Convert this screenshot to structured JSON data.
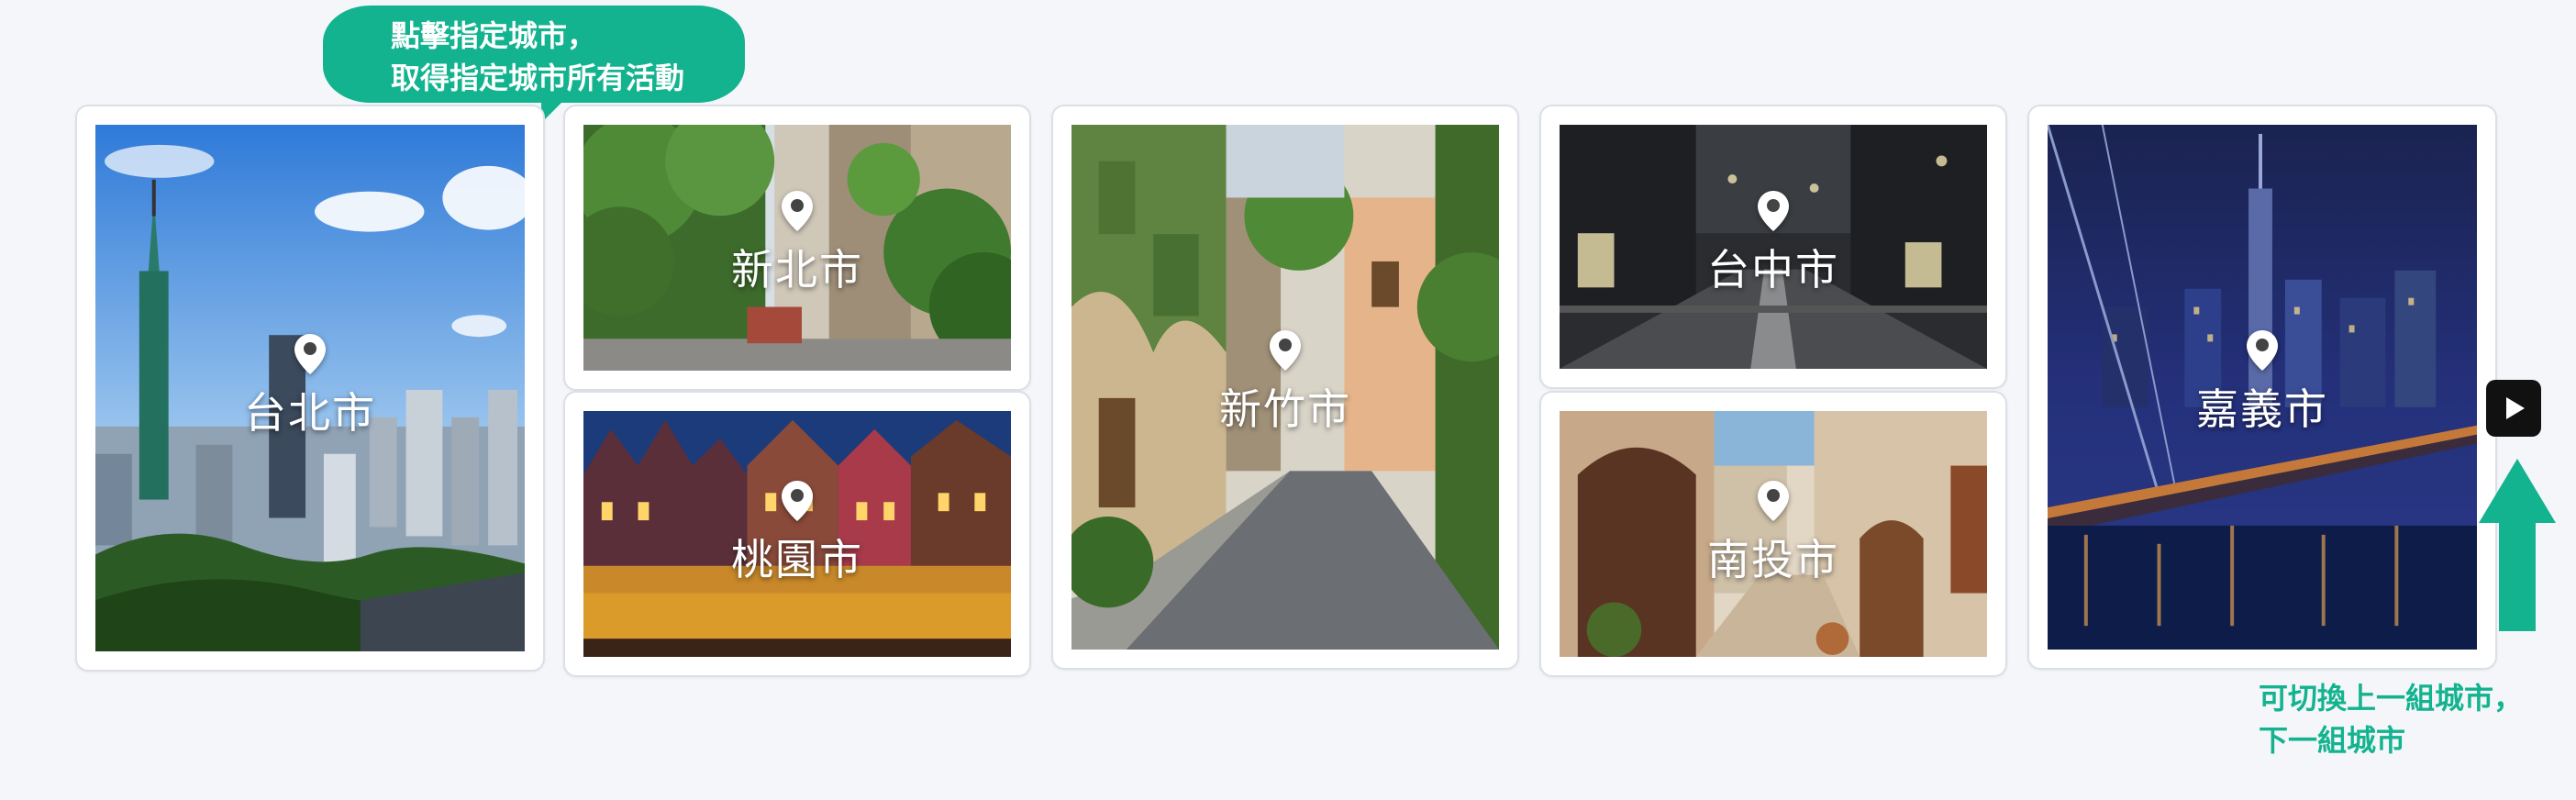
{
  "tooltip": {
    "line1": "點擊指定城市，",
    "line2": "取得指定城市所有活動"
  },
  "cities": {
    "taipei": {
      "name": "台北市"
    },
    "new_taipei": {
      "name": "新北市"
    },
    "taoyuan": {
      "name": "桃園市"
    },
    "hsinchu": {
      "name": "新竹市"
    },
    "taichung": {
      "name": "台中市"
    },
    "nantou": {
      "name": "南投市"
    },
    "chiayi": {
      "name": "嘉義市"
    }
  },
  "hint": {
    "line1": "可切換上一組城市，",
    "line2": "下一組城市"
  },
  "icons": {
    "pin": "map-pin-icon",
    "next": "caret-right-icon",
    "arrow": "arrow-up-icon"
  },
  "colors": {
    "accent": "#13b38f",
    "card_border": "#dcdfe6",
    "background": "#f5f6fa"
  }
}
